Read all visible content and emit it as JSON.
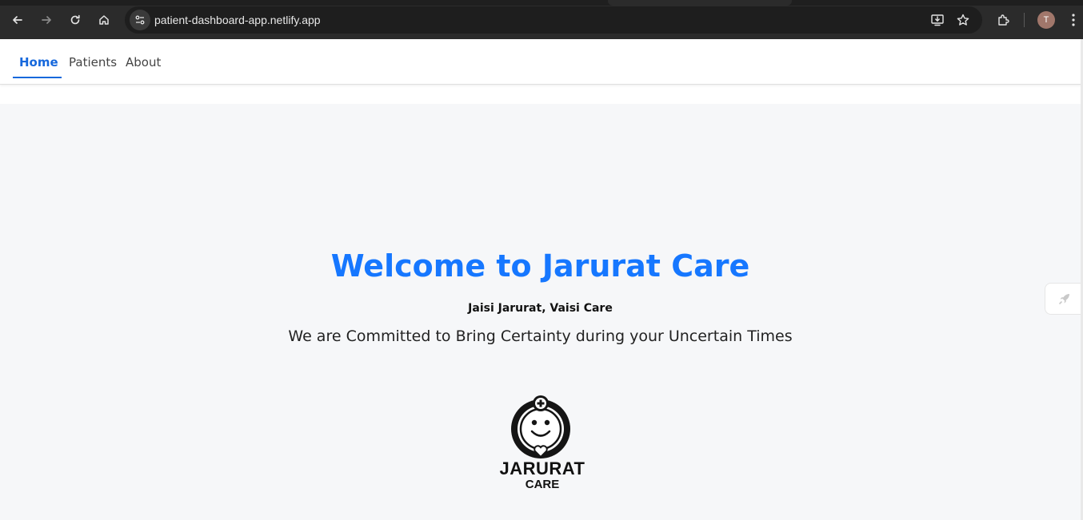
{
  "browser": {
    "url": "patient-dashboard-app.netlify.app",
    "profile_initial": "T"
  },
  "nav": {
    "items": [
      {
        "label": "Home",
        "active": true
      },
      {
        "label": "Patients",
        "active": false
      },
      {
        "label": "About",
        "active": false
      }
    ]
  },
  "hero": {
    "title": "Welcome to Jarurat Care",
    "tagline": "Jaisi Jarurat, Vaisi Care",
    "mission": "We are Committed to Bring Certainty during your Uncertain Times"
  },
  "logo": {
    "line1": "JARURAT",
    "line2": "CARE"
  },
  "colors": {
    "accent": "#1677ff",
    "background": "#f6f7f9"
  }
}
